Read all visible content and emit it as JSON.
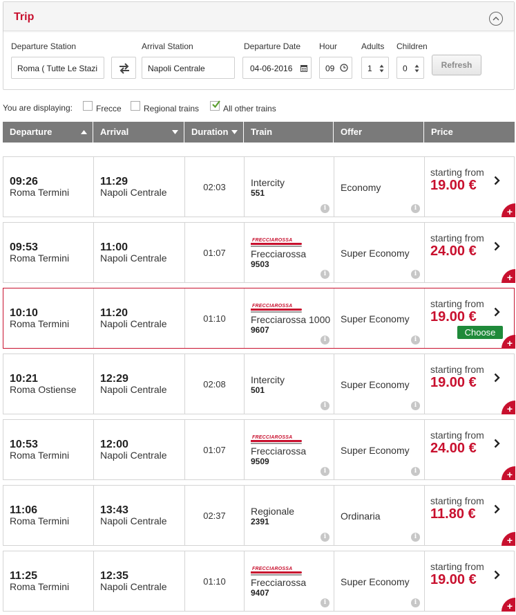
{
  "trip": {
    "title": "Trip",
    "departure_station_label": "Departure Station",
    "departure_station_value": "Roma ( Tutte Le Stazi",
    "arrival_station_label": "Arrival Station",
    "arrival_station_value": "Napoli Centrale",
    "departure_date_label": "Departure Date",
    "departure_date_value": "04-06-2016",
    "hour_label": "Hour",
    "hour_value": "09",
    "adults_label": "Adults",
    "adults_value": "1",
    "children_label": "Children",
    "children_value": "0",
    "refresh_label": "Refresh"
  },
  "filters": {
    "displaying_label": "You are displaying:",
    "options": [
      {
        "label": "Frecce",
        "checked": false
      },
      {
        "label": "Regional trains",
        "checked": false
      },
      {
        "label": "All other trains",
        "checked": true
      }
    ]
  },
  "columns": {
    "departure": "Departure",
    "arrival": "Arrival",
    "duration": "Duration",
    "train": "Train",
    "offer": "Offer",
    "price": "Price"
  },
  "frecciarossa_logo_text": "FRECCIAROSSA",
  "starting_from_label": "starting from",
  "choose_label": "Choose",
  "rows": [
    {
      "dep_time": "09:26",
      "dep_station": "Roma Termini",
      "arr_time": "11:29",
      "arr_station": "Napoli Centrale",
      "duration": "02:03",
      "train_name": "Intercity",
      "train_number": "551",
      "frecciarossa": false,
      "offer": "Economy",
      "price": "19.00 €"
    },
    {
      "dep_time": "09:53",
      "dep_station": "Roma Termini",
      "arr_time": "11:00",
      "arr_station": "Napoli Centrale",
      "duration": "01:07",
      "train_name": "Frecciarossa",
      "train_number": "9503",
      "frecciarossa": true,
      "offer": "Super Economy",
      "price": "24.00 €"
    },
    {
      "dep_time": "10:10",
      "dep_station": "Roma Termini",
      "arr_time": "11:20",
      "arr_station": "Napoli Centrale",
      "duration": "01:10",
      "train_name": "Frecciarossa 1000",
      "train_number": "9607",
      "frecciarossa": true,
      "offer": "Super Economy",
      "price": "19.00 €"
    },
    {
      "dep_time": "10:21",
      "dep_station": "Roma Ostiense",
      "arr_time": "12:29",
      "arr_station": "Napoli Centrale",
      "duration": "02:08",
      "train_name": "Intercity",
      "train_number": "501",
      "frecciarossa": false,
      "offer": "Super Economy",
      "price": "19.00 €"
    },
    {
      "dep_time": "10:53",
      "dep_station": "Roma Termini",
      "arr_time": "12:00",
      "arr_station": "Napoli Centrale",
      "duration": "01:07",
      "train_name": "Frecciarossa",
      "train_number": "9509",
      "frecciarossa": true,
      "offer": "Super Economy",
      "price": "24.00 €"
    },
    {
      "dep_time": "11:06",
      "dep_station": "Roma Termini",
      "arr_time": "13:43",
      "arr_station": "Napoli Centrale",
      "duration": "02:37",
      "train_name": "Regionale",
      "train_number": "2391",
      "frecciarossa": false,
      "offer": "Ordinaria",
      "price": "11.80 €"
    },
    {
      "dep_time": "11:25",
      "dep_station": "Roma Termini",
      "arr_time": "12:35",
      "arr_station": "Napoli Centrale",
      "duration": "01:10",
      "train_name": "Frecciarossa",
      "train_number": "9407",
      "frecciarossa": true,
      "offer": "Super Economy",
      "price": "19.00 €"
    }
  ],
  "selected_row": 2,
  "colors": {
    "brand_red": "#c8102e",
    "header_gray": "#7a7a7a",
    "choose_green": "#1f8a3a"
  }
}
